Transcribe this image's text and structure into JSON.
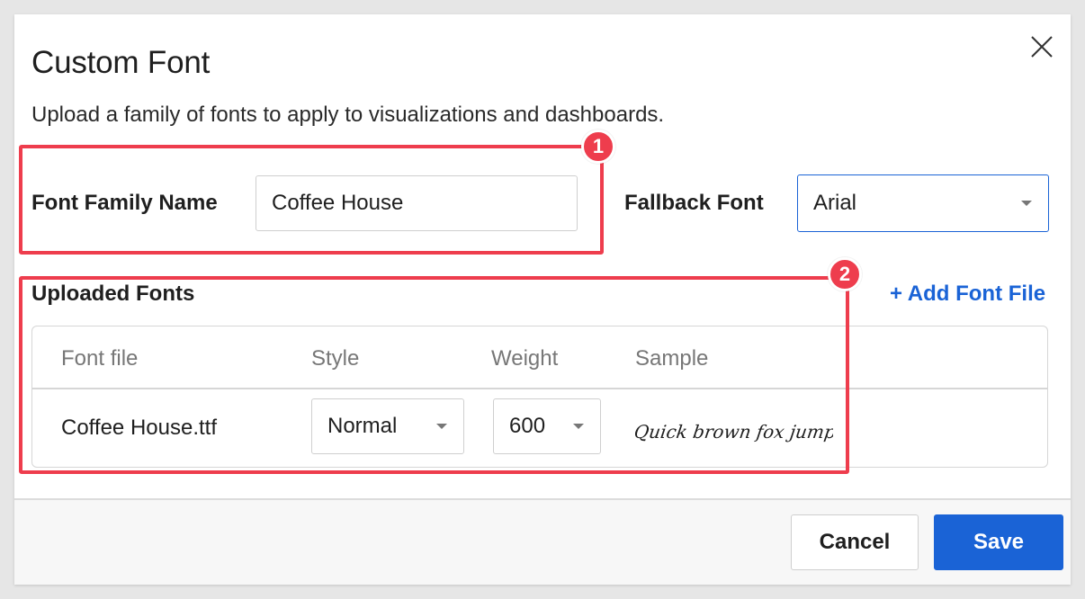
{
  "dialog": {
    "title": "Custom Font",
    "subtitle": "Upload a family of fonts to apply to visualizations and dashboards.",
    "close_icon": "close-icon"
  },
  "form": {
    "font_family_label": "Font Family Name",
    "font_family_value": "Coffee House",
    "fallback_label": "Fallback Font",
    "fallback_value": "Arial"
  },
  "uploaded": {
    "section_label": "Uploaded Fonts",
    "add_link": "+ Add Font File",
    "columns": [
      "Font file",
      "Style",
      "Weight",
      "Sample"
    ],
    "rows": [
      {
        "file": "Coffee House.ttf",
        "style": "Normal",
        "weight": "600",
        "sample": "Quick brown fox jumped"
      }
    ]
  },
  "footer": {
    "cancel_label": "Cancel",
    "save_label": "Save"
  },
  "annotations": {
    "badge_1": "1",
    "badge_2": "2",
    "color": "#ee3d4d"
  },
  "colors": {
    "accent": "#1a63d6"
  }
}
